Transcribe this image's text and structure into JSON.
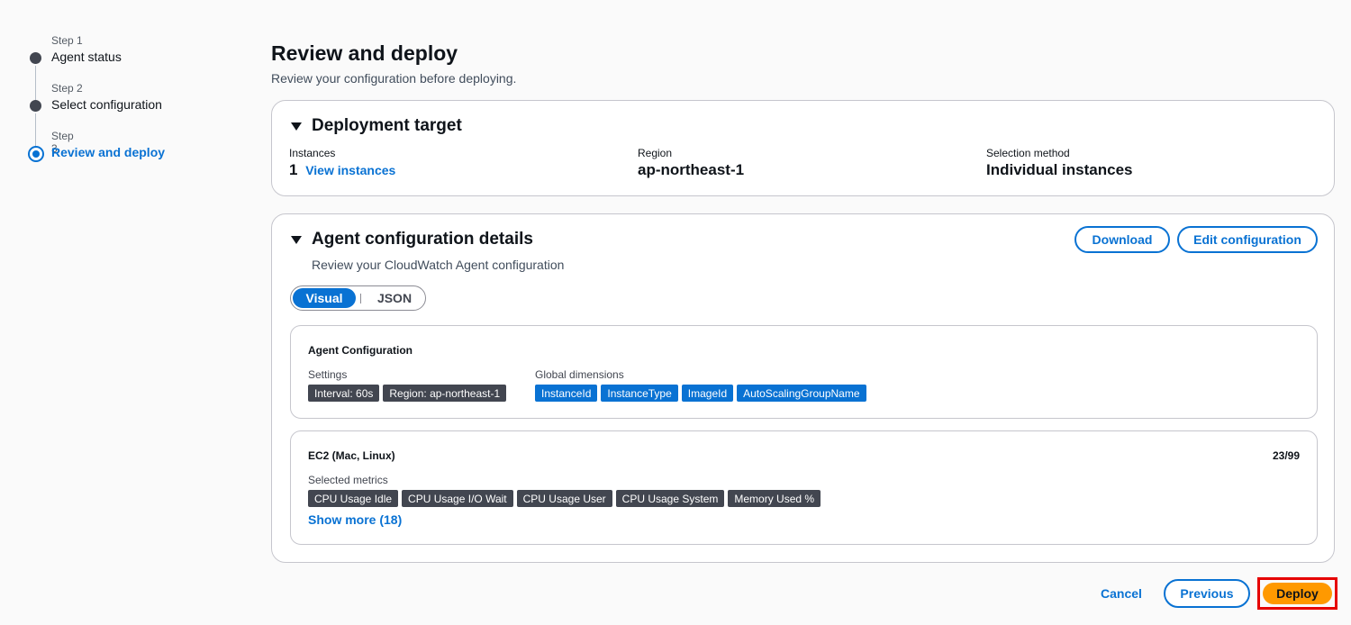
{
  "wizard": {
    "steps": [
      {
        "number": "Step 1",
        "title": "Agent status"
      },
      {
        "number": "Step 2",
        "title": "Select configuration"
      },
      {
        "number": "Step 3",
        "title": "Review and deploy"
      }
    ],
    "active_step": 3
  },
  "header": {
    "title": "Review and deploy",
    "description": "Review your configuration before deploying."
  },
  "deployment_target": {
    "title": "Deployment target",
    "instances_label": "Instances",
    "instances_count": "1",
    "view_instances_link": "View instances",
    "region_label": "Region",
    "region_value": "ap-northeast-1",
    "selection_label": "Selection method",
    "selection_value": "Individual instances"
  },
  "agent_config": {
    "title": "Agent configuration details",
    "description": "Review your CloudWatch Agent configuration",
    "download_label": "Download",
    "edit_label": "Edit configuration",
    "view_toggle": {
      "options": [
        "Visual",
        "JSON"
      ],
      "selected": "Visual"
    },
    "config_card": {
      "title": "Agent Configuration",
      "settings_label": "Settings",
      "settings": [
        "Interval: 60s",
        "Region: ap-northeast-1"
      ],
      "dimensions_label": "Global dimensions",
      "dimensions": [
        "InstanceId",
        "InstanceType",
        "ImageId",
        "AutoScalingGroupName"
      ]
    },
    "ec2_card": {
      "title": "EC2 (Mac, Linux)",
      "count": "23/99",
      "metrics_label": "Selected metrics",
      "metrics": [
        "CPU Usage Idle",
        "CPU Usage I/O Wait",
        "CPU Usage User",
        "CPU Usage System",
        "Memory Used %"
      ],
      "show_more": "Show more (18)"
    }
  },
  "footer": {
    "cancel_label": "Cancel",
    "previous_label": "Previous",
    "deploy_label": "Deploy"
  },
  "colors": {
    "primary": "#0972d3",
    "deploy": "#ff9900",
    "highlight": "#e60000",
    "tag_dark": "#424650"
  }
}
